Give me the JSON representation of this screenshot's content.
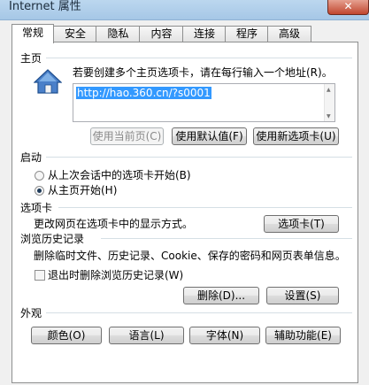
{
  "window": {
    "title": "Internet 属性",
    "close_glyph": "✕"
  },
  "tabs": [
    {
      "label": "常规",
      "active": true
    },
    {
      "label": "安全"
    },
    {
      "label": "隐私"
    },
    {
      "label": "内容"
    },
    {
      "label": "连接"
    },
    {
      "label": "程序"
    },
    {
      "label": "高级"
    }
  ],
  "home": {
    "section_label": "主页",
    "instruction": "若要创建多个主页选项卡，请在每行输入一个地址(R)。",
    "url_value": "http://hao.360.cn/?s0001",
    "buttons": {
      "use_current": "使用当前页(C)",
      "use_default": "使用默认值(F)",
      "use_new_tab": "使用新选项卡(U)"
    }
  },
  "startup": {
    "section_label": "启动",
    "option_last_session": "从上次会话中的选项卡开始(B)",
    "option_home": "从主页开始(H)"
  },
  "tabs_section": {
    "section_label": "选项卡",
    "description": "更改网页在选项卡中的显示方式。",
    "button": "选项卡(T)"
  },
  "history": {
    "section_label": "浏览历史记录",
    "description": "删除临时文件、历史记录、Cookie、保存的密码和网页表单信息。",
    "checkbox_label": "退出时删除浏览历史记录(W)",
    "delete_button": "删除(D)...",
    "settings_button": "设置(S)"
  },
  "appearance": {
    "section_label": "外观",
    "colors_button": "颜色(O)",
    "languages_button": "语言(L)",
    "fonts_button": "字体(N)",
    "accessibility_button": "辅助功能(E)"
  }
}
